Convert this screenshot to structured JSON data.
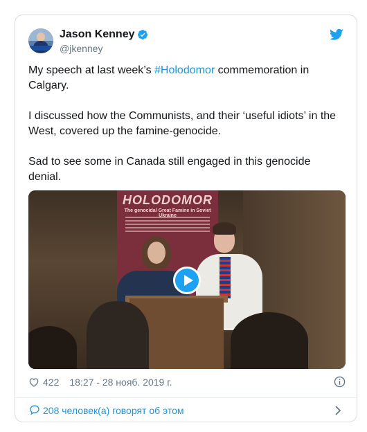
{
  "tweet": {
    "author_name": "Jason Kenney",
    "handle": "@jkenney",
    "paragraph1_before": "My speech at last week’s ",
    "hashtag": "#Holodomor",
    "paragraph1_after": " commemoration in Calgary.",
    "paragraph2": "I discussed how the Communists, and their ‘useful idiots’ in the West, covered up the famine-genocide.",
    "paragraph3": "Sad to see some in Canada still engaged in this genocide denial."
  },
  "media": {
    "poster_title": "HOLODOMOR",
    "poster_subtitle": "The genocidal Great Famine in Soviet Ukraine"
  },
  "meta": {
    "likes": "422",
    "timestamp": "18:27 - 28 нояб. 2019 г."
  },
  "footer": {
    "talking_text": "208 человек(а) говорят об этом"
  },
  "colors": {
    "accent": "#1b95e0",
    "twitter_blue": "#1da1f2",
    "secondary_text": "#657786"
  },
  "icons": [
    "verified-icon",
    "twitter-logo-icon",
    "play-icon",
    "heart-icon",
    "info-icon",
    "comment-bubble-icon",
    "chevron-right-icon"
  ]
}
